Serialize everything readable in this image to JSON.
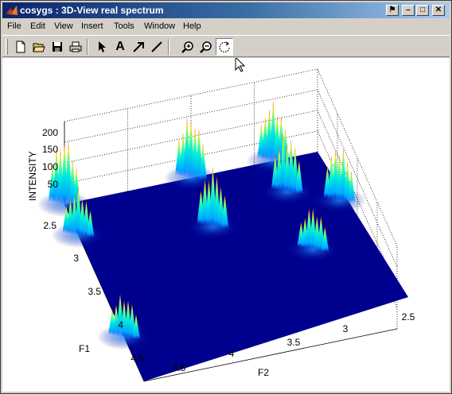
{
  "window": {
    "title": "cosygs : 3D-View real spectrum",
    "controls": [
      "⚑",
      "–",
      "□",
      "✕"
    ]
  },
  "menu": [
    "File",
    "Edit",
    "View",
    "Insert",
    "Tools",
    "Window",
    "Help"
  ],
  "toolbar": [
    {
      "name": "new-figure-icon"
    },
    {
      "name": "open-file-icon"
    },
    {
      "name": "save-icon"
    },
    {
      "name": "print-icon"
    },
    {
      "name": "select-arrow-icon"
    },
    {
      "name": "insert-text-icon",
      "glyph": "A"
    },
    {
      "name": "insert-arrow-icon"
    },
    {
      "name": "insert-line-icon"
    },
    {
      "name": "zoom-in-icon"
    },
    {
      "name": "zoom-out-icon"
    },
    {
      "name": "rotate-3d-icon",
      "pressed": true
    }
  ],
  "colors": {
    "surface_base": "#00008f",
    "peak_low": "#00c0ff",
    "peak_mid": "#40ff60",
    "peak_high": "#ff4000"
  },
  "chart_data": {
    "type": "surface",
    "zlabel": "INTENSITY",
    "xlabel": "F2",
    "ylabel": "F1",
    "zticks": [
      "200",
      "150",
      "100",
      "50"
    ],
    "f1ticks": [
      "2.5",
      "3",
      "3.5",
      "4",
      "4.5"
    ],
    "f2ticks": [
      "2.5",
      "3",
      "3.5",
      "4",
      "4.5"
    ],
    "zlim": [
      0,
      200
    ],
    "grid": true,
    "peaks": [
      {
        "f1": 2.5,
        "f2": 4.5,
        "z": 170
      },
      {
        "f1": 2.85,
        "f2": 4.5,
        "z": 120
      },
      {
        "f1": 4.0,
        "f2": 4.5,
        "z": 110
      },
      {
        "f1": 2.5,
        "f2": 3.5,
        "z": 160
      },
      {
        "f1": 3.05,
        "f2": 3.5,
        "z": 150
      },
      {
        "f1": 2.5,
        "f2": 2.85,
        "z": 150
      },
      {
        "f1": 2.85,
        "f2": 2.85,
        "z": 150
      },
      {
        "f1": 3.5,
        "f2": 2.85,
        "z": 110
      },
      {
        "f1": 3.05,
        "f2": 2.5,
        "z": 140
      }
    ]
  }
}
